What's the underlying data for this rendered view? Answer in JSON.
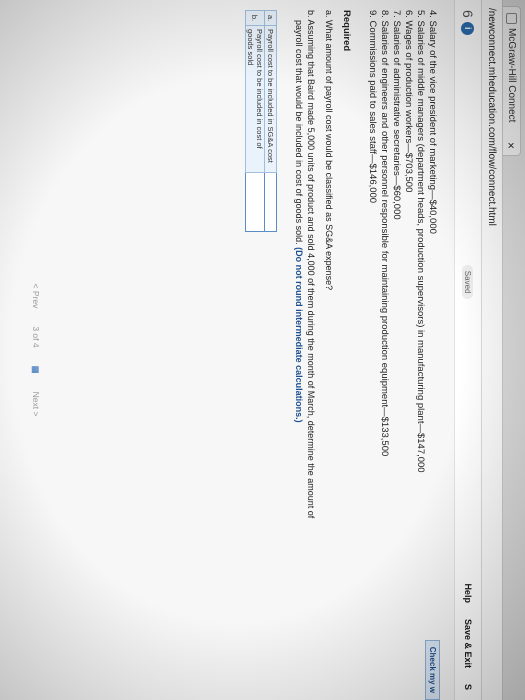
{
  "browser": {
    "tab_title": "McGraw-Hill Connect",
    "tab_close": "×",
    "url": "/newconnect.mheducation.com/flow/connect.html"
  },
  "appbar": {
    "question_number": "6",
    "info_icon": "i",
    "saved_label": "Saved",
    "help_label": "Help",
    "save_exit_label": "Save & Exit",
    "submit_label": "S"
  },
  "problem": {
    "check_label": "Check my w",
    "items": [
      "4. Salary of the vice president of marketing—$40,000",
      "5. Salaries of middle managers (department heads, production supervisors) in manufacturing plant—$147,000",
      "6. Wages of production workers—$703,500",
      "7. Salaries of administrative secretaries—$60,000",
      "8. Salaries of engineers and other personnel responsible for maintaining production equipment—$133,500",
      "9. Commissions paid to sales staff—$146,000"
    ],
    "required_heading": "Required",
    "req_a": "a. What amount of payroll cost would be classified as SG&A expense?",
    "req_b_line1": "b. Assuming that Baird made 5,000 units of product and sold 4,000 of them during the month of March, determine the amount of",
    "req_b_line2": "payroll cost that would be included in cost of goods sold.",
    "req_b_note": "(Do not round intermediate calculations.)"
  },
  "answer_table": {
    "rows": [
      {
        "label": "a.",
        "description": "Payroll cost to be included in SG&A cost",
        "value": ""
      },
      {
        "label": "b.",
        "description": "Payroll cost to be included in cost of goods sold",
        "value": ""
      }
    ]
  },
  "pager": {
    "prev_label": "< Prev",
    "position": "3 of 4",
    "grid_icon": "grid-icon",
    "next_label": "Next >"
  }
}
